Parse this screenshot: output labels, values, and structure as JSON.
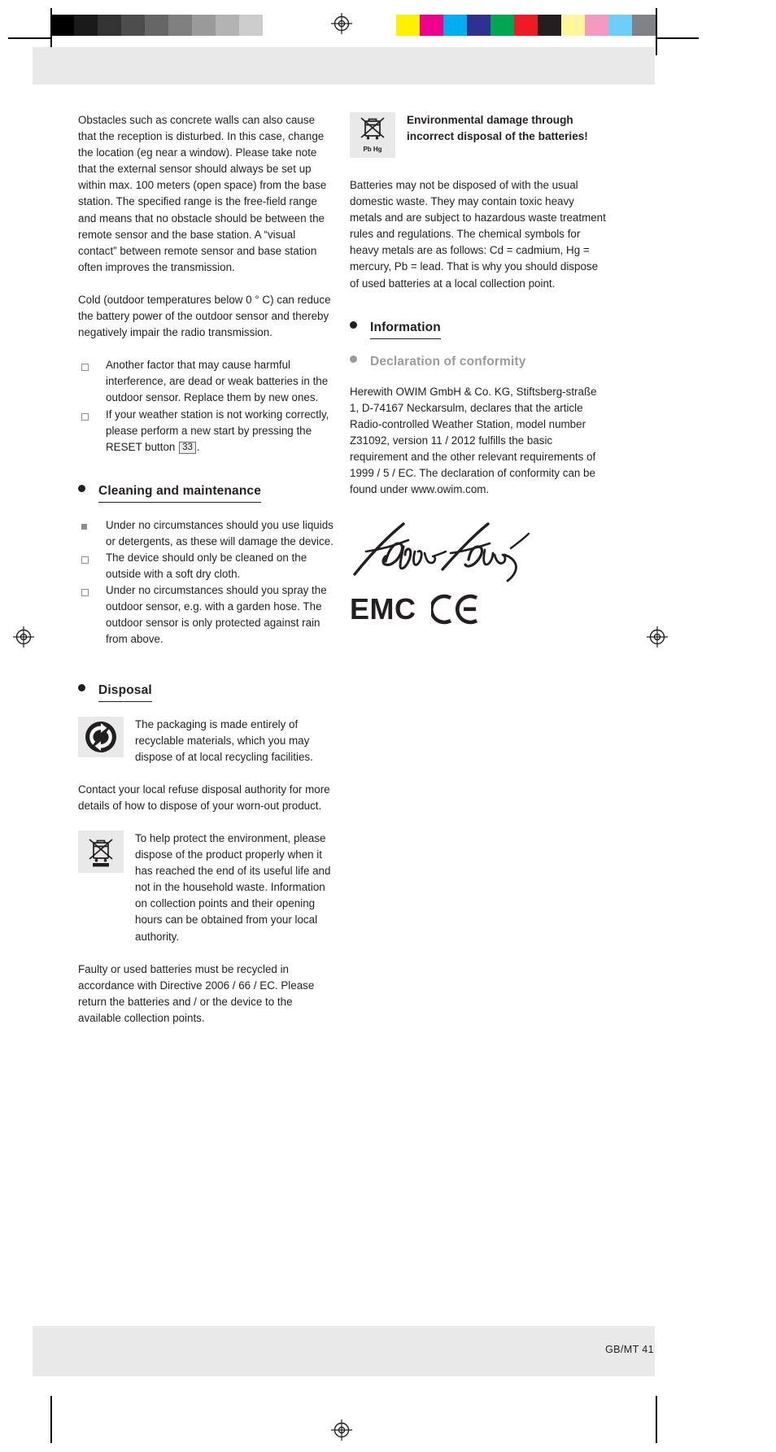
{
  "page": {
    "folio": "GB/MT   41"
  },
  "calibration": {
    "gray_swatches": [
      "#000000",
      "#1a1a1a",
      "#333333",
      "#4d4d4d",
      "#666666",
      "#808080",
      "#9a9a9a",
      "#b3b3b3",
      "#cccccc",
      "#ffffff"
    ],
    "color_swatches": [
      "#fff200",
      "#ec008c",
      "#00aeef",
      "#2e3192",
      "#00a651",
      "#ed1c24",
      "#231f20",
      "#fff799",
      "#f49ac1",
      "#6dcff6",
      "#808285"
    ]
  },
  "left_column": {
    "paragraph_obstacles": "Obstacles such as concrete walls can also cause that the reception is disturbed. In this case, change the location (eg near a window). Please take note that the external sensor should always be set up within max. 100 meters (open space) from the base station. The specified range is the free-field range and means that no obstacle should be between the remote sensor and the base station. A “visual contact” between remote sensor and base station often improves the transmission.",
    "paragraph_cold": "Cold (outdoor temperatures below 0 ° C) can reduce the battery power of the outdoor sensor and thereby negatively impair the radio transmission.",
    "troubleshoot_items": [
      {
        "marker": "hollow",
        "text": "Another factor that may cause harmful interference, are dead or weak batteries in the outdoor sensor. Replace them by new ones."
      },
      {
        "marker": "hollow",
        "text_before": "If your weather station is not working correctly, please perform a new start by pressing the RESET button",
        "ref": "33",
        "text_after": "."
      }
    ],
    "heading_cleaning": "Cleaning and maintenance",
    "cleaning_items": [
      {
        "marker": "filled",
        "text": "Under no circumstances should you use liquids or detergents, as these will damage the device."
      },
      {
        "marker": "hollow",
        "text": "The device should only be cleaned on the outside with a soft dry cloth."
      },
      {
        "marker": "hollow",
        "text": "Under no circumstances should you spray the outdoor sensor, e.g. with a garden hose. The outdoor sensor is only protected against rain from above."
      }
    ],
    "heading_disposal": "Disposal",
    "packaging_icon": "green-dot-recycling-icon",
    "packaging_text": "The packaging is made entirely of recyclable materials, which you may dispose of at local recycling facilities.",
    "paragraph_contact": "Contact your local refuse disposal authority for more details of how to dispose of your worn-out product.",
    "weee_icon": "crossed-out-wheelie-bin-icon",
    "weee_text": "To help protect the environment, please dispose of the product properly when it has reached the end of its useful life and not in the household waste. Information on collection points and their opening hours can be obtained from your local authority.",
    "paragraph_batteries_directive": "Faulty or used batteries must be recycled in accordance with Directive 2006 / 66 / EC. Please return the batteries and / or the device to the available collection points."
  },
  "right_column": {
    "battery_icon": "crossed-out-wheelie-bin-battery-icon",
    "battery_icon_label": "Pb Hg",
    "battery_warning_heading": "Environmental damage through incorrect disposal of the batteries!",
    "paragraph_batteries": "Batteries may not be disposed of with the usual domestic waste. They may contain toxic heavy metals and are subject to hazardous waste treatment rules and regulations. The chemical symbols for heavy metals are as follows: Cd = cadmium, Hg = mercury, Pb = lead. That is why you should dispose of used batteries at a local collection point.",
    "heading_information": "Information",
    "heading_declaration": "Declaration of conformity",
    "paragraph_declaration": "Herewith OWIM GmbH & Co. KG, Stiftsberg-straße 1, D-74167 Neckarsulm, declares that the article Radio-controlled Weather Station, model number Z31092, version 11 / 2012 fulfills the basic requirement and the other relevant requirements of 1999 / 5 / EC. The declaration of conformity can be found under www.owim.com.",
    "signature_name": "Tobias Koenig",
    "emc_label": "EMC",
    "ce_label": "CE"
  }
}
